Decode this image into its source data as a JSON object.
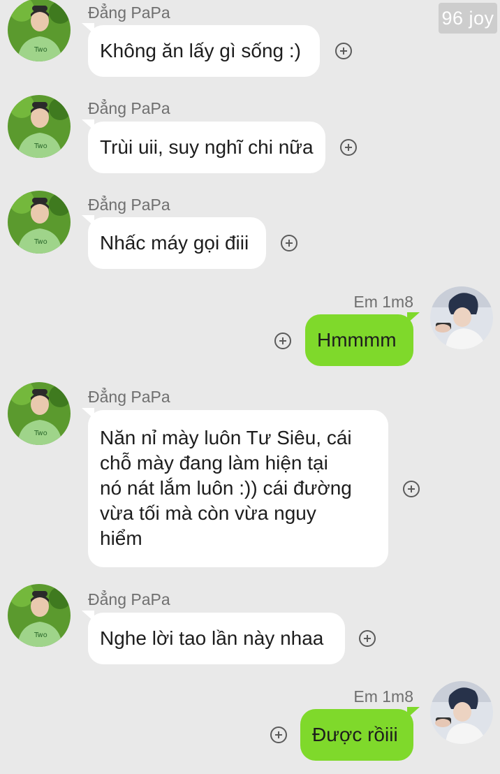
{
  "watermark": "96 joy",
  "colors": {
    "background": "#e9e9e9",
    "incoming_bubble": "#ffffff",
    "outgoing_bubble": "#7fd92b",
    "sender_name": "#6f6f6f"
  },
  "messages": [
    {
      "sender": "Đẳng PaPa",
      "text": "Không ăn lấy gì sống :)",
      "direction": "incoming",
      "avatar_icon": "avatar-papa-icon",
      "action_icon": "add-reaction-icon"
    },
    {
      "sender": "Đẳng PaPa",
      "text": "Trùi uii, suy nghĩ chi nữa",
      "direction": "incoming",
      "avatar_icon": "avatar-papa-icon",
      "action_icon": "add-reaction-icon"
    },
    {
      "sender": "Đẳng PaPa",
      "text": "Nhấc máy gọi điii",
      "direction": "incoming",
      "avatar_icon": "avatar-papa-icon",
      "action_icon": "add-reaction-icon"
    },
    {
      "sender": "Em 1m8",
      "text": "Hmmmm",
      "direction": "outgoing",
      "avatar_icon": "avatar-em-icon",
      "action_icon": "add-reaction-icon"
    },
    {
      "sender": "Đẳng PaPa",
      "text": "Năn nỉ mày luôn Tư Siêu, cái\nchỗ mày đang làm hiện tại\nnó nát lắm luôn :)) cái đường\nvừa tối mà còn vừa nguy\nhiểm",
      "direction": "incoming",
      "avatar_icon": "avatar-papa-icon",
      "action_icon": "add-reaction-icon"
    },
    {
      "sender": "Đẳng PaPa",
      "text": "Nghe lời tao lần này nhaa",
      "direction": "incoming",
      "avatar_icon": "avatar-papa-icon",
      "action_icon": "add-reaction-icon"
    },
    {
      "sender": "Em 1m8",
      "text": "Được rồiii",
      "direction": "outgoing",
      "avatar_icon": "avatar-em-icon",
      "action_icon": "add-reaction-icon"
    }
  ]
}
